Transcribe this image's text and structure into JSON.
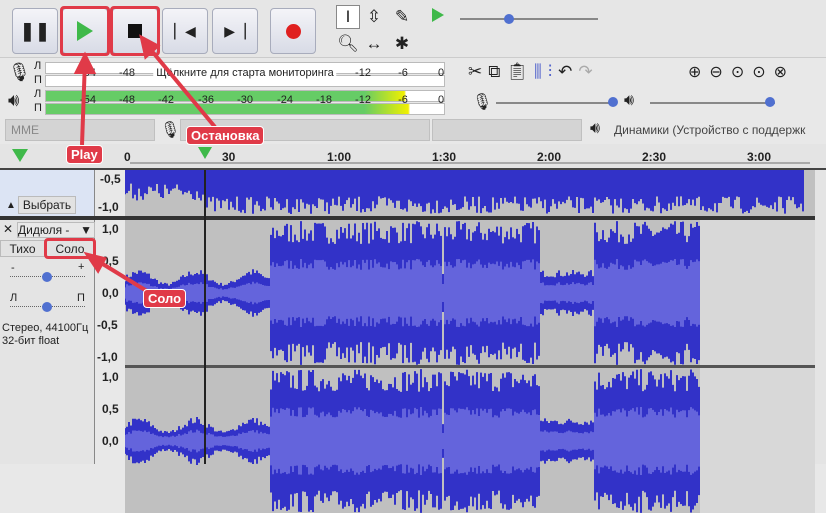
{
  "transport": {
    "pause": "pause-icon",
    "play": "play-icon",
    "stop": "stop-icon",
    "skip_start": "skip-start-icon",
    "skip_end": "skip-end-icon",
    "record": "record-icon"
  },
  "meters": {
    "rec_ticks": [
      "-54",
      "-48",
      "-12",
      "-6",
      "0"
    ],
    "rec_hint": "Щёлкните для старта мониторинга",
    "play_ticks": [
      "-54",
      "-48",
      "-42",
      "-36",
      "-30",
      "-24",
      "-18",
      "-12",
      "-6",
      "0"
    ],
    "ch_left": "Л",
    "ch_right": "П"
  },
  "devices": {
    "host": "MME",
    "output": "Динамики (Устройство с поддержк"
  },
  "timeline": {
    "labels": [
      "0",
      "30",
      "1:00",
      "1:30",
      "2:00",
      "2:30",
      "3:00"
    ]
  },
  "track1": {
    "scale": [
      "-0,5",
      "-1,0"
    ],
    "select": "Выбрать"
  },
  "track2": {
    "name": "Дидюля -",
    "mute": "Тихо",
    "solo": "Соло",
    "gain_minus": "-",
    "gain_plus": "+",
    "pan_left": "Л",
    "pan_right": "П",
    "format1": "Стерео, 44100Гц",
    "format2": "32-бит float",
    "scale1": [
      "1,0",
      "0,5",
      "0,0",
      "-0,5",
      "-1,0"
    ],
    "scale2": [
      "1,0",
      "0,5",
      "0,0"
    ]
  },
  "annotations": {
    "play": "Play",
    "stop": "Остановка",
    "solo": "Соло"
  },
  "colors": {
    "wave": "#3232c8",
    "wave_rms": "#6464dc",
    "annotation": "#e03a48",
    "meter_green": "#66cc66"
  }
}
